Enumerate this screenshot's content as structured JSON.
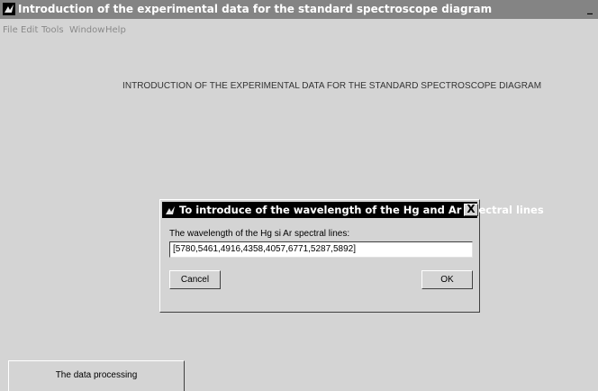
{
  "window": {
    "title": "Introduction of the experimental data for the standard spectroscope diagram",
    "minimize_glyph": "_"
  },
  "menu": [
    "File",
    "Edit",
    "Tools",
    "Window",
    "Help"
  ],
  "main": {
    "heading": "INTRODUCTION OF THE EXPERIMENTAL DATA FOR THE STANDARD SPECTROSCOPE DIAGRAM",
    "processing_button": "The data processing"
  },
  "dialog": {
    "title": "To introduce of the wavelength of the Hg and Ar spectral lines",
    "close_glyph": "X",
    "prompt": "The wavelength of the Hg si Ar spectral lines:",
    "value": "[5780,5461,4916,4358,4057,6771,5287,5892]",
    "cancel_label": "Cancel",
    "ok_label": "OK"
  },
  "icons": [
    "matlab-window-icon",
    "matlab-dialog-icon",
    "close-icon"
  ]
}
